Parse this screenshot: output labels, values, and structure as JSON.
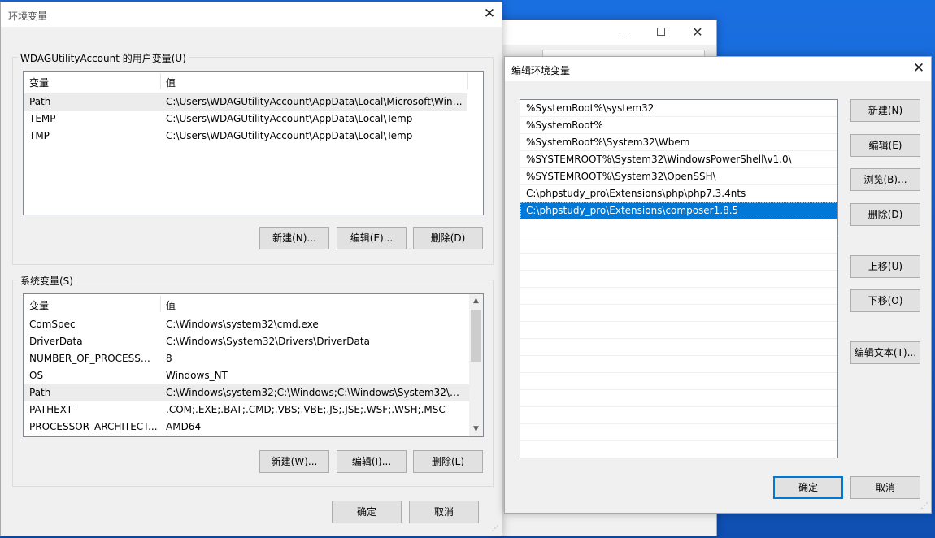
{
  "colors": {
    "selection": "#0078d7",
    "desktop": "#1665d6",
    "button_face": "#e1e1e1"
  },
  "env_dialog": {
    "title": "环境变量",
    "close_icon": "close-icon",
    "user_group": {
      "legend": "WDAGUtilityAccount 的用户变量(U)",
      "headers": [
        "变量",
        "值"
      ],
      "rows": [
        {
          "name": "Path",
          "value": "C:\\Users\\WDAGUtilityAccount\\AppData\\Local\\Microsoft\\Wind..."
        },
        {
          "name": "TEMP",
          "value": "C:\\Users\\WDAGUtilityAccount\\AppData\\Local\\Temp"
        },
        {
          "name": "TMP",
          "value": "C:\\Users\\WDAGUtilityAccount\\AppData\\Local\\Temp"
        }
      ],
      "buttons": {
        "new": "新建(N)...",
        "edit": "编辑(E)...",
        "delete": "删除(D)"
      }
    },
    "system_group": {
      "legend": "系统变量(S)",
      "headers": [
        "变量",
        "值"
      ],
      "rows": [
        {
          "name": "ComSpec",
          "value": "C:\\Windows\\system32\\cmd.exe"
        },
        {
          "name": "DriverData",
          "value": "C:\\Windows\\System32\\Drivers\\DriverData"
        },
        {
          "name": "NUMBER_OF_PROCESSORS",
          "value": "8"
        },
        {
          "name": "OS",
          "value": "Windows_NT"
        },
        {
          "name": "Path",
          "value": "C:\\Windows\\system32;C:\\Windows;C:\\Windows\\System32\\Wb..."
        },
        {
          "name": "PATHEXT",
          "value": ".COM;.EXE;.BAT;.CMD;.VBS;.VBE;.JS;.JSE;.WSF;.WSH;.MSC"
        },
        {
          "name": "PROCESSOR_ARCHITECT...",
          "value": "AMD64"
        }
      ],
      "buttons": {
        "new": "新建(W)...",
        "edit": "编辑(I)...",
        "delete": "删除(L)"
      }
    },
    "ok": "确定",
    "cancel": "取消"
  },
  "bg_window": {
    "minimize_icon": "minimize-icon",
    "maximize_icon": "maximize-icon",
    "close_icon": "close-icon"
  },
  "edit_dialog": {
    "title": "编辑环境变量",
    "close_icon": "close-icon",
    "entries": [
      "%SystemRoot%\\system32",
      "%SystemRoot%",
      "%SystemRoot%\\System32\\Wbem",
      "%SYSTEMROOT%\\System32\\WindowsPowerShell\\v1.0\\",
      "%SYSTEMROOT%\\System32\\OpenSSH\\",
      "C:\\phpstudy_pro\\Extensions\\php\\php7.3.4nts",
      "C:\\phpstudy_pro\\Extensions\\composer1.8.5"
    ],
    "selected_index": 6,
    "buttons": {
      "new": "新建(N)",
      "edit": "编辑(E)",
      "browse": "浏览(B)...",
      "delete": "删除(D)",
      "move_up": "上移(U)",
      "move_down": "下移(O)",
      "edit_text": "编辑文本(T)..."
    },
    "ok": "确定",
    "cancel": "取消"
  }
}
